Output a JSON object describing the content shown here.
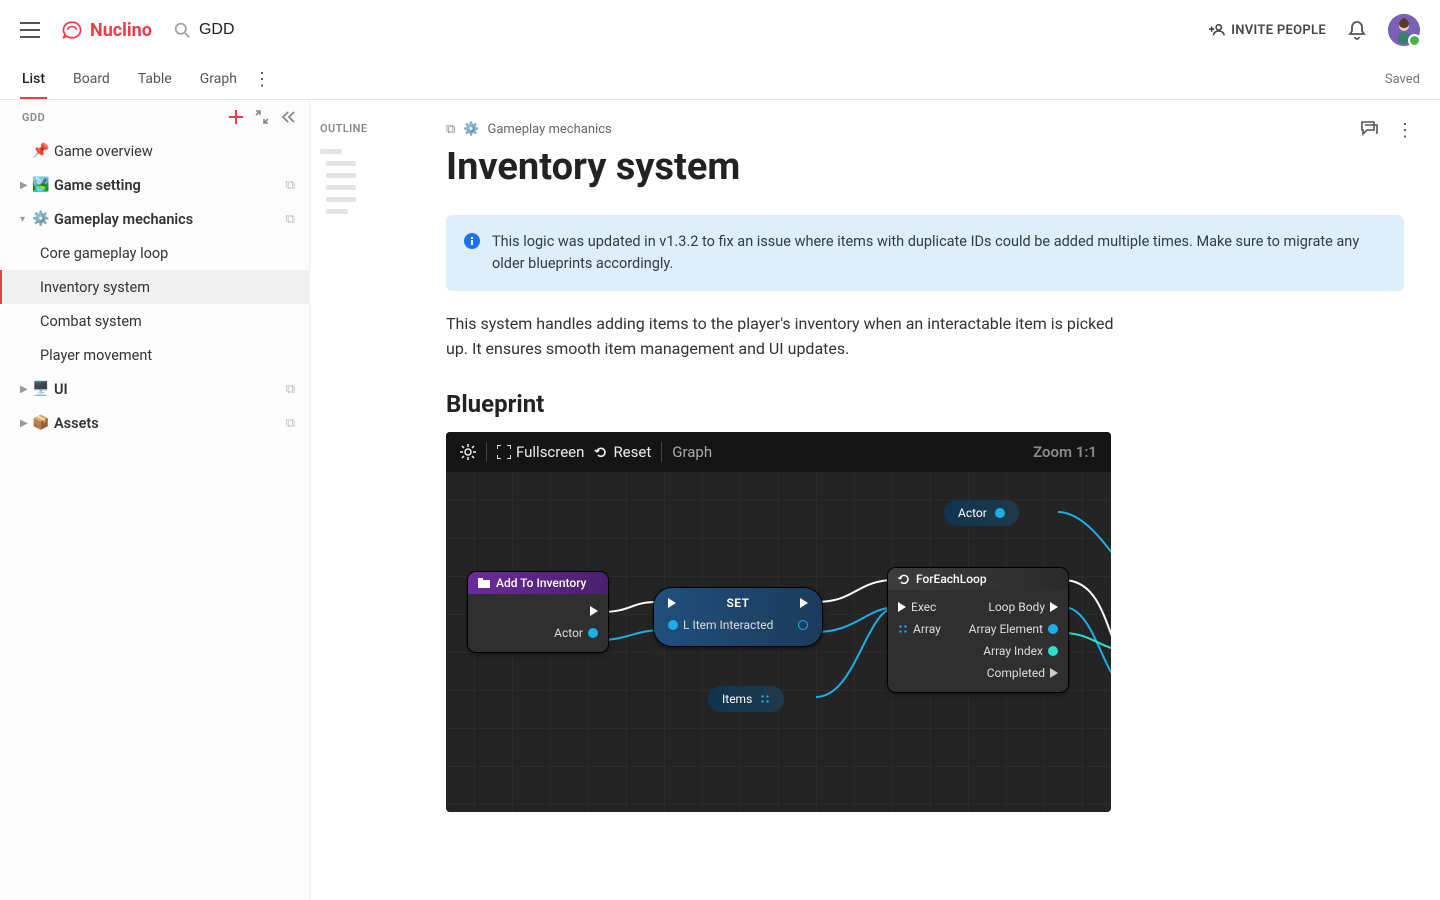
{
  "app": {
    "name": "Nuclino",
    "search_value": "GDD"
  },
  "header": {
    "invite_label": "INVITE PEOPLE",
    "saved_label": "Saved"
  },
  "tabs": [
    "List",
    "Board",
    "Table",
    "Graph"
  ],
  "active_tab": "List",
  "sidebar": {
    "title": "GDD",
    "tree": [
      {
        "emoji": "📌",
        "label": "Game overview",
        "bold": false,
        "expandable": false
      },
      {
        "emoji": "🏞️",
        "label": "Game setting",
        "bold": true,
        "expandable": true,
        "icon_dup": true
      },
      {
        "emoji": "⚙️",
        "label": "Gameplay mechanics",
        "bold": true,
        "expandable": true,
        "open": true,
        "icon_dup": true,
        "children": [
          "Core gameplay loop",
          "Inventory system",
          "Combat system",
          "Player movement"
        ],
        "selected": "Inventory system"
      },
      {
        "emoji": "🖥️",
        "label": "UI",
        "bold": true,
        "expandable": true,
        "icon_dup": true
      },
      {
        "emoji": "📦",
        "label": "Assets",
        "bold": true,
        "expandable": true,
        "icon_dup": true
      }
    ]
  },
  "outline": {
    "label": "OUTLINE"
  },
  "doc": {
    "breadcrumb_icon": "gear-icon",
    "breadcrumb": "Gameplay mechanics",
    "title": "Inventory system",
    "callout": "This logic was updated in v1.3.2 to fix an issue where items with duplicate IDs could be added multiple times. Make sure to migrate any older blueprints accordingly.",
    "body": "This system handles adding items to the player's inventory when an interactable item is picked up. It ensures smooth item management and UI updates.",
    "section": "Blueprint"
  },
  "blueprint": {
    "toolbar": {
      "fullscreen": "Fullscreen",
      "reset": "Reset",
      "mode": "Graph",
      "zoom": "Zoom 1:1"
    },
    "nodes": {
      "actor_pill": "Actor",
      "add_to_inventory": {
        "title": "Add To Inventory",
        "out_actor": "Actor"
      },
      "set": {
        "title": "SET",
        "item": "L Item Interacted"
      },
      "items_pill": "Items",
      "foreach": {
        "title": "ForEachLoop",
        "in_exec": "Exec",
        "in_array": "Array",
        "out_loop": "Loop Body",
        "out_elem": "Array Element",
        "out_idx": "Array Index",
        "out_done": "Completed"
      }
    }
  }
}
